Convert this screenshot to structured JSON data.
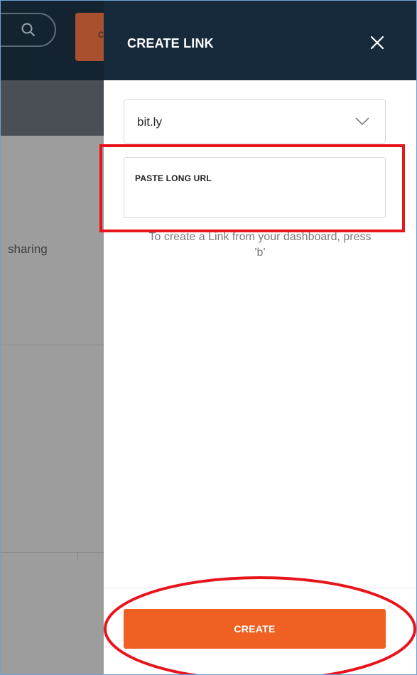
{
  "background": {
    "orange_button_fragment": "c",
    "sharing_text": "sharing"
  },
  "panel": {
    "title": "CREATE LINK",
    "domain_value": "bit.ly",
    "url_placeholder": "PASTE LONG URL",
    "hint": "To create a Link from your dashboard, press 'b'",
    "create_label": "CREATE"
  },
  "icons": {
    "search": "search-icon",
    "close": "close-icon",
    "dropdown": "chevron-down-icon"
  },
  "colors": {
    "panel_header": "#172a3b",
    "create_button": "#ee6123",
    "annotation": "#e8141c",
    "frame_border": "#6fa0d8"
  }
}
